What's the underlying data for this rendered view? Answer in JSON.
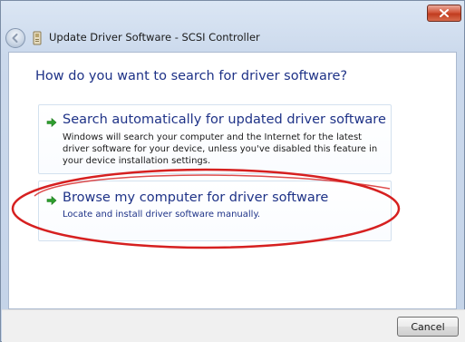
{
  "window": {
    "title": "Update Driver Software - SCSI Controller"
  },
  "heading": "How do you want to search for driver software?",
  "options": [
    {
      "title": "Search automatically for updated driver software",
      "description": "Windows will search your computer and the Internet for the latest driver software for your device, unless you've disabled this feature in your device installation settings.",
      "icon": "green-arrow-icon"
    },
    {
      "title": "Browse my computer for driver software",
      "description": "Locate and install driver software manually.",
      "icon": "green-arrow-icon",
      "highlighted": true
    }
  ],
  "footer": {
    "cancel_label": "Cancel"
  },
  "colors": {
    "link_blue": "#1e3287",
    "arrow_green": "#2e9e2e",
    "highlight_red": "#d62020",
    "close_red": "#c13c1f"
  }
}
